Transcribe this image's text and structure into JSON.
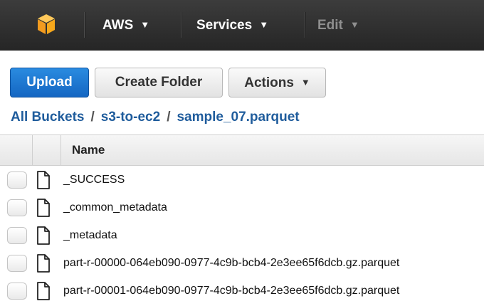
{
  "topnav": {
    "menus": [
      {
        "label": "AWS"
      },
      {
        "label": "Services"
      },
      {
        "label": "Edit"
      }
    ]
  },
  "toolbar": {
    "upload_label": "Upload",
    "create_folder_label": "Create Folder",
    "actions_label": "Actions"
  },
  "breadcrumb": {
    "items": [
      "All Buckets",
      "s3-to-ec2",
      "sample_07.parquet"
    ],
    "separator": "/"
  },
  "table": {
    "header_name": "Name",
    "rows": [
      {
        "name": "_SUCCESS"
      },
      {
        "name": "_common_metadata"
      },
      {
        "name": "_metadata"
      },
      {
        "name": "part-r-00000-064eb090-0977-4c9b-bcb4-2e3ee65f6dcb.gz.parquet"
      },
      {
        "name": "part-r-00001-064eb090-0977-4c9b-bcb4-2e3ee65f6dcb.gz.parquet"
      }
    ]
  },
  "colors": {
    "nav_background": "#2f2f2f",
    "primary_button": "#1f77d0",
    "link": "#1f5c9c",
    "logo": "#f7a81b"
  },
  "icons": {
    "logo": "aws-cube-icon",
    "dropdown": "chevron-down-icon",
    "file": "file-icon"
  }
}
